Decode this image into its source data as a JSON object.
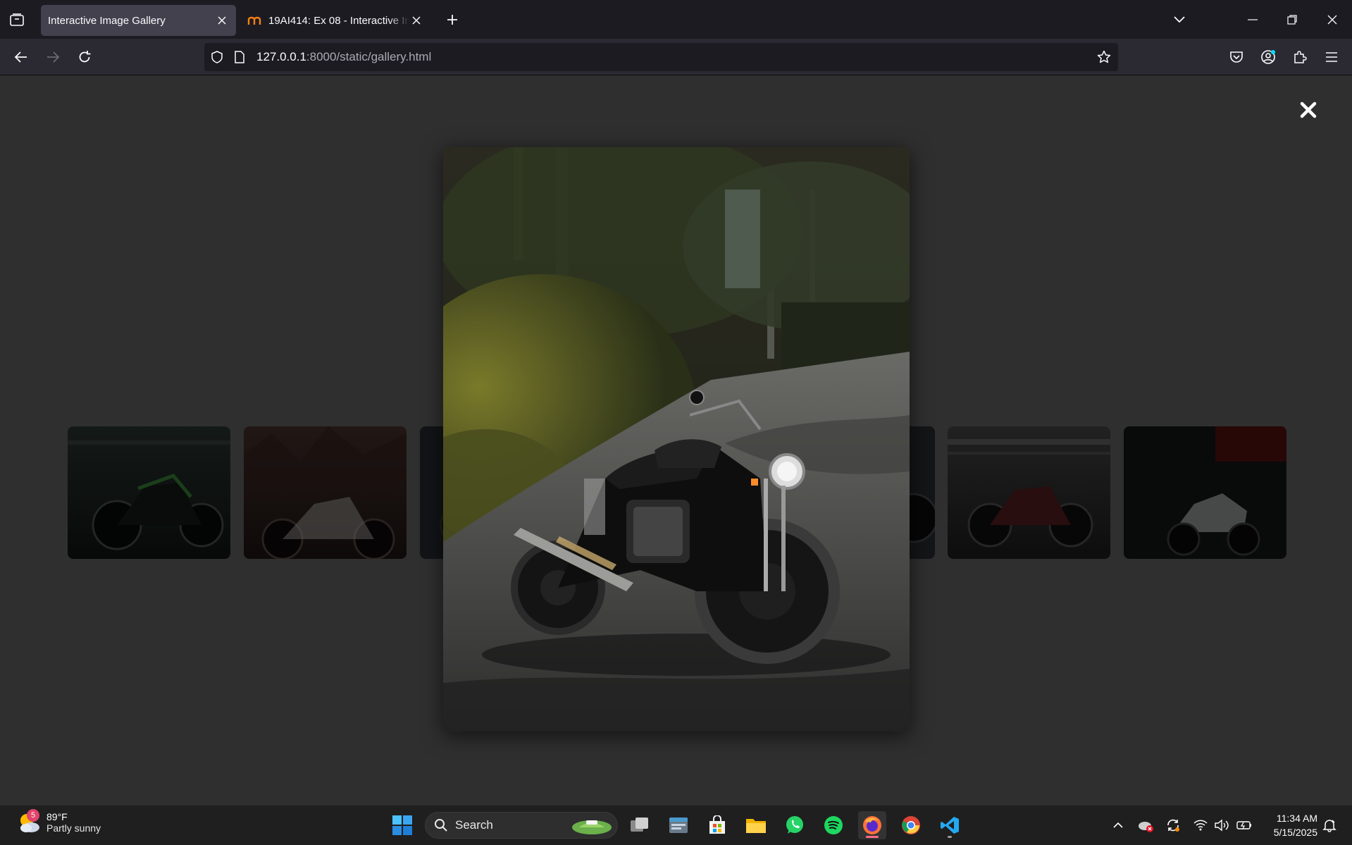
{
  "browser": {
    "tabs": [
      {
        "title": "Interactive Image Gallery",
        "active": true
      },
      {
        "title": "19AI414: Ex 08 - Interactive Ima",
        "active": false
      }
    ],
    "url": {
      "host": "127.0.0.1",
      "path": ":8000/static/gallery.html"
    }
  },
  "gallery": {
    "thumbnails": [
      {
        "subject": "green-black motorcycle in showroom",
        "colors": [
          "#1e2a26",
          "#0c110f"
        ]
      },
      {
        "subject": "white sport motorcycle among autumn trees",
        "colors": [
          "#3a2a25",
          "#1b1412"
        ]
      },
      {
        "subject": "motorcycle",
        "colors": [
          "#2a2d33",
          "#14161a"
        ]
      },
      {
        "subject": "motorcycle",
        "colors": [
          "#2a2c30",
          "#121316"
        ]
      },
      {
        "subject": "motorcycle",
        "colors": [
          "#2c2f33",
          "#141518"
        ]
      },
      {
        "subject": "red motorcycle on bridge",
        "colors": [
          "#3a3a3a",
          "#1a1a1a"
        ]
      },
      {
        "subject": "white sport bike with red wall",
        "colors": [
          "#2a1010",
          "#101212"
        ]
      }
    ],
    "lightbox": {
      "subject": "black cafe racer motorcycle on tree-lined road"
    }
  },
  "taskbar": {
    "weather": {
      "badge": "5",
      "temp": "89°F",
      "desc": "Partly sunny"
    },
    "search": {
      "placeholder": "Search"
    },
    "clock": {
      "time": "11:34 AM",
      "date": "5/15/2025"
    }
  },
  "colors": {
    "accent": "#0078d4",
    "page_bg": "#2f2f2f",
    "firefox_indicator": "#ff6b8a"
  }
}
